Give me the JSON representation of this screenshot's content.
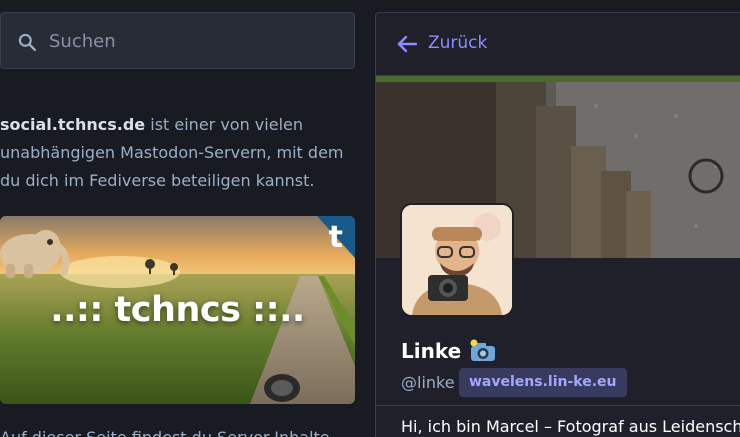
{
  "search": {
    "placeholder": "Suchen",
    "icon": "search-icon"
  },
  "about": {
    "server_name": "social.tchncs.de",
    "description_line1": " ist einer von vielen",
    "description_line2": "unabhängigen Mastodon-Servern, mit dem",
    "description_line3": "du dich im Fediverse beteiligen kannst."
  },
  "hero": {
    "title": "..:: tchncs ::..",
    "badge_letter": "t"
  },
  "bottom": {
    "text": "Auf dieser Seite findest du Server-Inhalte"
  },
  "profile": {
    "back_label": "Zurück",
    "display_name": "Linke",
    "handle": "@linke",
    "domain_badge": "wavelens.lin-ke.eu",
    "bio": "Hi, ich bin Marcel – Fotograf aus Leidenschaft"
  },
  "colors": {
    "background": "#191b22",
    "panel": "#1f2029",
    "accent": "#8c8dff",
    "muted_text": "#9baec8",
    "badge_bg": "#383b5e"
  }
}
